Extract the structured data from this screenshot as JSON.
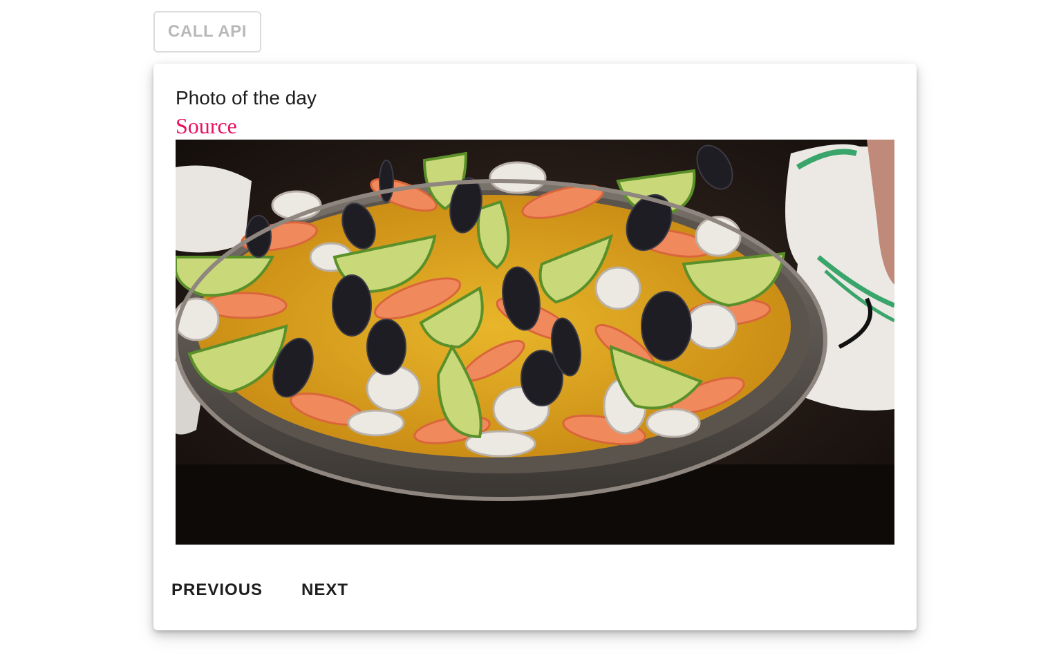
{
  "toolbar": {
    "call_api_label": "CALL API"
  },
  "card": {
    "title": "Photo of the day",
    "source_label": "Source",
    "image_subject": "seafood paella",
    "previous_label": "PREVIOUS",
    "next_label": "NEXT"
  },
  "colors": {
    "source_link": "#e8105f",
    "disabled_button_text": "#b8b8b8"
  }
}
